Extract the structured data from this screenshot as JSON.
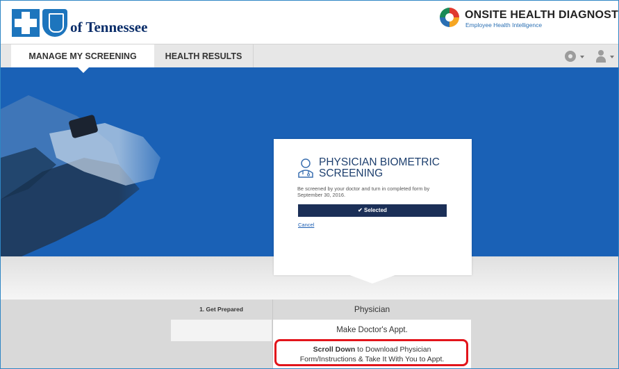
{
  "header": {
    "brand_left": "of Tennessee",
    "brand_right_name": "ONSITE HEALTH DIAGNOSTICS",
    "brand_right_tagline": "Employee Health Intelligence"
  },
  "nav": {
    "tabs": [
      {
        "label": "MANAGE MY SCREENING",
        "active": true
      },
      {
        "label": "HEALTH RESULTS",
        "active": false
      }
    ],
    "icons": [
      "gear-icon",
      "user-icon"
    ]
  },
  "card": {
    "title": "PHYSICIAN BIOMETRIC SCREENING",
    "description": "Be screened by your doctor and turn in completed form by September 30, 2016.",
    "selected_label": "✔ Selected",
    "cancel_label": "Cancel"
  },
  "steps": {
    "step_label": "1. Get Prepared",
    "column_header": "Physician",
    "row1": "Make Doctor's Appt.",
    "row2_bold": "Scroll Down",
    "row2_rest_line1": " to Download Physician",
    "row2_line2": "Form/Instructions & Take It With You to Appt."
  },
  "colors": {
    "hero_blue": "#1a61b6",
    "button_navy": "#1b2f57",
    "highlight_red": "#e2141b",
    "brand_blue": "#1d75bd"
  }
}
